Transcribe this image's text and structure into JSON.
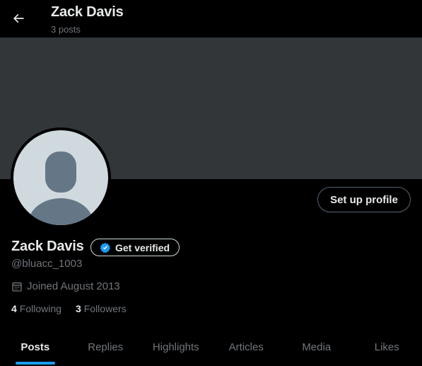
{
  "header": {
    "title": "Zack Davis",
    "posts_count": "3 posts",
    "back_icon": "arrow-left-icon"
  },
  "colors": {
    "background": "#000000",
    "banner": "#333639",
    "avatar_bg": "#cfd9de",
    "avatar_silhouette": "#657786",
    "accent": "#1d9bf0",
    "muted_text": "#71767b",
    "primary_text": "#e7e9ea"
  },
  "profile": {
    "name": "Zack Davis",
    "handle": "@bluacc_1003",
    "joined": "Joined August 2013",
    "setup_button": "Set up profile",
    "verify_button": "Get verified",
    "verify_icon": "verified-badge-icon",
    "calendar_icon": "calendar-icon",
    "following_count": "4",
    "following_label": "Following",
    "followers_count": "3",
    "followers_label": "Followers"
  },
  "tabs": [
    {
      "label": "Posts",
      "active": true
    },
    {
      "label": "Replies",
      "active": false
    },
    {
      "label": "Highlights",
      "active": false
    },
    {
      "label": "Articles",
      "active": false
    },
    {
      "label": "Media",
      "active": false
    },
    {
      "label": "Likes",
      "active": false
    }
  ]
}
